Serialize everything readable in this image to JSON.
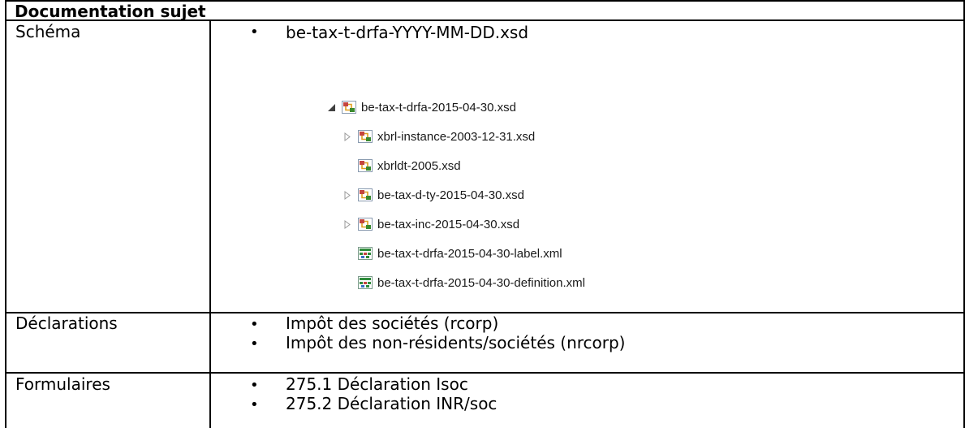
{
  "header": {
    "title": "Documentation sujet"
  },
  "schema": {
    "label": "Schéma",
    "pattern": "be-tax-t-drfa-YYYY-MM-DD.xsd",
    "tree": {
      "root": "be-tax-t-drfa-2015-04-30.xsd",
      "children": [
        {
          "name": "xbrl-instance-2003-12-31.xsd",
          "icon": "xsd-schema-icon",
          "expandable": true
        },
        {
          "name": "xbrldt-2005.xsd",
          "icon": "xsd-schema-icon",
          "expandable": false
        },
        {
          "name": "be-tax-d-ty-2015-04-30.xsd",
          "icon": "xsd-schema-icon",
          "expandable": true
        },
        {
          "name": "be-tax-inc-2015-04-30.xsd",
          "icon": "xsd-schema-icon",
          "expandable": true
        },
        {
          "name": "be-tax-t-drfa-2015-04-30-label.xml",
          "icon": "xml-linkbase-icon",
          "expandable": false
        },
        {
          "name": "be-tax-t-drfa-2015-04-30-definition.xml",
          "icon": "xml-linkbase-icon",
          "expandable": false
        }
      ]
    }
  },
  "declarations": {
    "label": "Déclarations",
    "items": [
      "Impôt des sociétés (rcorp)",
      "Impôt des non-résidents/sociétés (nrcorp)"
    ]
  },
  "formulaires": {
    "label": "Formulaires",
    "items": [
      "275.1 Déclaration Isoc",
      "275.2 Déclaration INR/soc"
    ]
  },
  "colors": {
    "xsd_icon_red": "#c4443f",
    "xsd_icon_green": "#3a8a2e",
    "xml_icon_green": "#2e8b3a",
    "tree_text": "#1a1a1a"
  }
}
